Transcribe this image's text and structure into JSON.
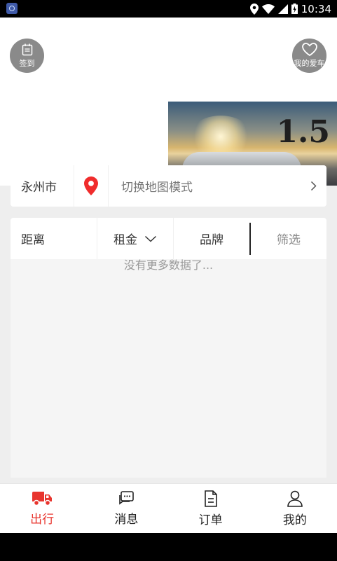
{
  "status_bar": {
    "time": "10:34"
  },
  "header": {
    "signin_label": "签到",
    "favorite_label": "我的爱车",
    "banner_text": "1.5"
  },
  "location": {
    "city": "永州市",
    "map_switch_label": "切换地图模式"
  },
  "filters": {
    "distance": "距离",
    "rent": "租金",
    "brand": "品牌",
    "filter": "筛选"
  },
  "list": {
    "empty_text": "没有更多数据了..."
  },
  "tabs": [
    {
      "label": "出行",
      "icon": "truck-icon",
      "active": true
    },
    {
      "label": "消息",
      "icon": "message-icon",
      "active": false
    },
    {
      "label": "订单",
      "icon": "document-icon",
      "active": false
    },
    {
      "label": "我的",
      "icon": "user-icon",
      "active": false
    }
  ],
  "colors": {
    "accent": "#e8352e",
    "pin": "#f02c2c"
  }
}
